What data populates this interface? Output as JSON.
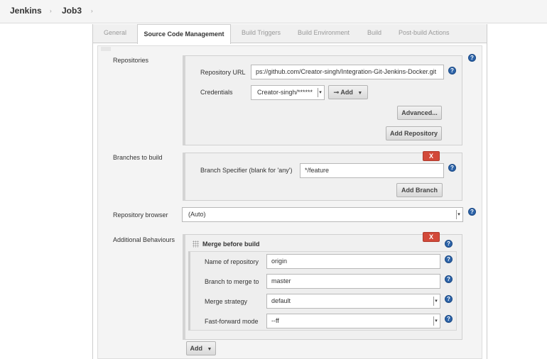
{
  "breadcrumb": {
    "items": [
      "Jenkins",
      "Job3"
    ]
  },
  "tabs": [
    "General",
    "Source Code Management",
    "Build Triggers",
    "Build Environment",
    "Build",
    "Post-build Actions"
  ],
  "active_tab": "Source Code Management",
  "repositories": {
    "label": "Repositories",
    "url_label": "Repository URL",
    "url_value": "ps://github.com/Creator-singh/Integration-Git-Jenkins-Docker.git",
    "credentials_label": "Credentials",
    "credentials_value": "Creator-singh/******",
    "add_label": "Add",
    "advanced_label": "Advanced...",
    "add_repository_label": "Add Repository"
  },
  "branches": {
    "label": "Branches to build",
    "specifier_label": "Branch Specifier (blank for 'any')",
    "specifier_value": "*/feature",
    "add_branch_label": "Add Branch",
    "delete_label": "X"
  },
  "repo_browser": {
    "label": "Repository browser",
    "value": "(Auto)"
  },
  "additional": {
    "label": "Additional Behaviours",
    "merge_title": "Merge before build",
    "delete_label": "X",
    "name_of_repo_label": "Name of repository",
    "name_of_repo_value": "origin",
    "branch_to_merge_label": "Branch to merge to",
    "branch_to_merge_value": "master",
    "merge_strategy_label": "Merge strategy",
    "merge_strategy_value": "default",
    "ff_mode_label": "Fast-forward mode",
    "ff_mode_value": "--ff",
    "add_label": "Add"
  },
  "help_glyph": "?",
  "colors": {
    "delete_button": "#d24939",
    "help_icon": "#2c63a8"
  }
}
